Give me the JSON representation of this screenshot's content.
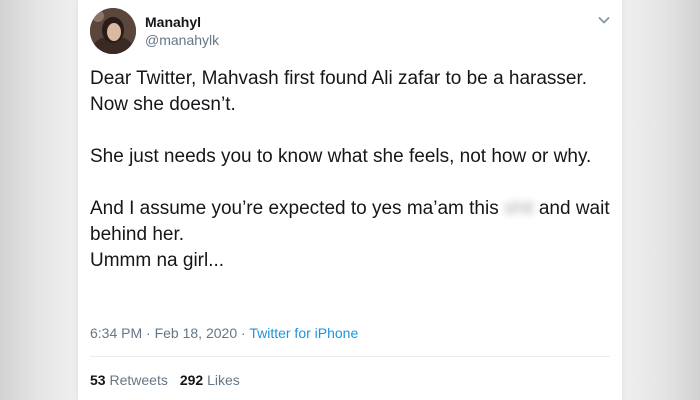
{
  "user": {
    "name": "Manahyl",
    "handle": "@manahylk"
  },
  "tweet": {
    "paragraph1": "Dear Twitter, Mahvash first found Ali zafar to be a harasser. Now she doesn’t.",
    "paragraph2": "She just needs you to know what she feels, not how or why.",
    "paragraph3_before": "And I assume you’re expected to yes ma’am this ",
    "paragraph3_blurred": "shit",
    "paragraph3_after": " and wait behind her.",
    "paragraph3_line2": "Ummm na girl..."
  },
  "meta": {
    "time": "6:34 PM",
    "separator1": " · ",
    "date": "Feb 18, 2020",
    "separator2": " · ",
    "source": "Twitter for iPhone"
  },
  "stats": {
    "retweets_count": "53",
    "retweets_label": "Retweets",
    "likes_count": "292",
    "likes_label": "Likes"
  },
  "colors": {
    "text": "#14171a",
    "secondary": "#657786",
    "link": "#1b95e0",
    "divider": "#e6ecf0"
  },
  "icons": {
    "caret": "chevron-down-icon"
  }
}
